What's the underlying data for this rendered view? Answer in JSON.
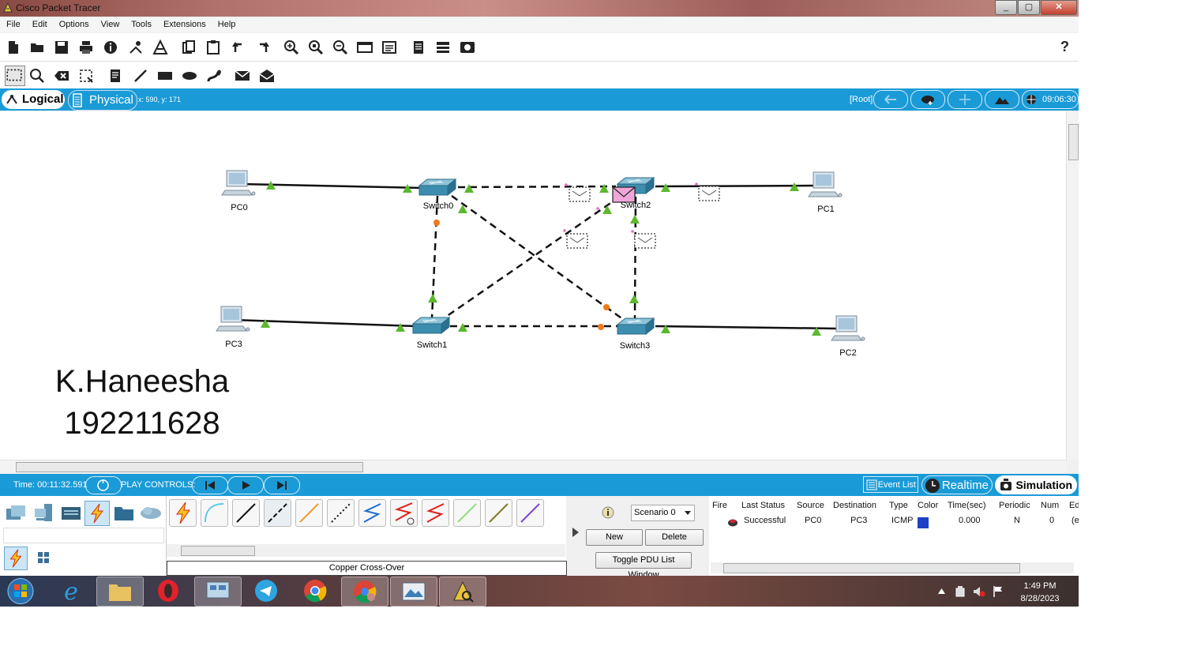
{
  "window": {
    "title": "Cisco Packet Tracer",
    "btn_min": "_",
    "btn_max": "▢",
    "btn_close": "✕"
  },
  "menu": [
    "File",
    "Edit",
    "Options",
    "View",
    "Tools",
    "Extensions",
    "Help"
  ],
  "toolbar": {
    "help": "?"
  },
  "modebar": {
    "logical": "Logical",
    "physical": "Physical",
    "coords": "x: 590, y: 171",
    "root": "[Root]",
    "clock": "09:06:30"
  },
  "topology": {
    "devices": [
      {
        "name": "PC0",
        "kind": "pc"
      },
      {
        "name": "PC1",
        "kind": "pc"
      },
      {
        "name": "PC3",
        "kind": "pc"
      },
      {
        "name": "PC2",
        "kind": "pc"
      },
      {
        "name": "Switch0",
        "kind": "switch"
      },
      {
        "name": "Switch2",
        "kind": "switch"
      },
      {
        "name": "Switch1",
        "kind": "switch"
      },
      {
        "name": "Switch3",
        "kind": "switch"
      }
    ],
    "annotation_name": "K.Haneesha",
    "annotation_id": "192211628"
  },
  "simbar": {
    "time": "Time: 00:11:32.591",
    "play_controls": "PLAY CONTROLS:",
    "event_list": "Event List",
    "realtime": "Realtime",
    "simulation": "Simulation"
  },
  "cables": {
    "selected_name": "Copper Cross-Over"
  },
  "scenario": {
    "selected": "Scenario 0",
    "new": "New",
    "delete": "Delete",
    "toggle": "Toggle PDU List Window"
  },
  "pdu_list": {
    "headers": [
      "Fire",
      "Last Status",
      "Source",
      "Destination",
      "Type",
      "Color",
      "Time(sec)",
      "Periodic",
      "Num",
      "Ed"
    ],
    "row": {
      "status": "Successful",
      "source": "PC0",
      "destination": "PC3",
      "type": "ICMP",
      "color": "#1f3fc4",
      "time": "0.000",
      "periodic": "N",
      "num": "0",
      "edit": "(e"
    }
  },
  "taskbar": {
    "time": "1:49 PM",
    "date": "8/28/2023"
  },
  "colors": {
    "accent": "#1a9bd7",
    "link_up": "#5cb82e",
    "link_orange": "#f07a1a",
    "pdu_envelope": "#f2a6d8"
  }
}
